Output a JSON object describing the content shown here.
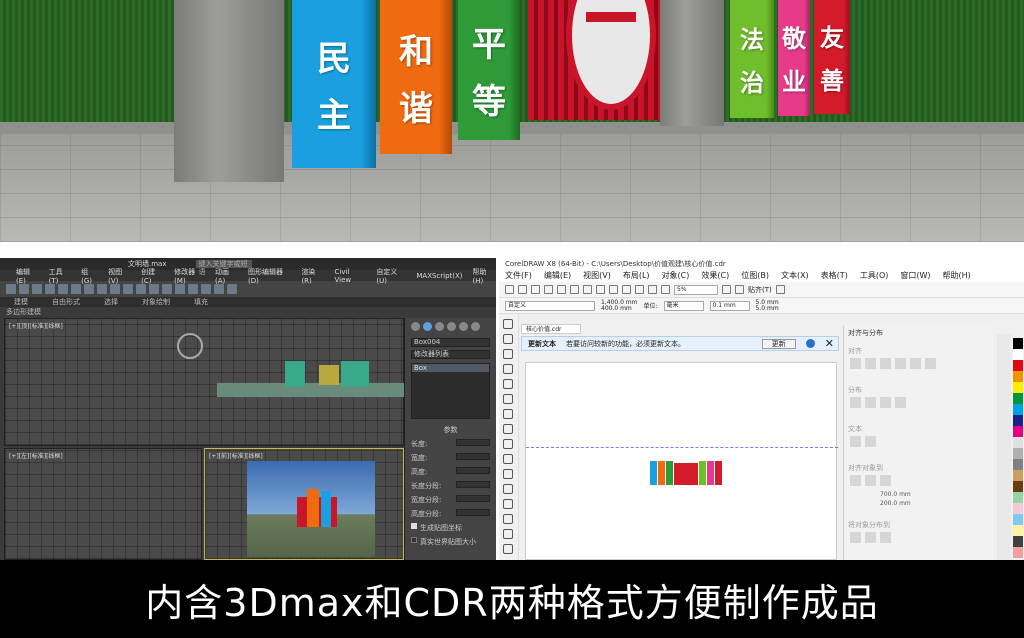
{
  "scene": {
    "boards": [
      {
        "text": [
          "民",
          "主"
        ],
        "color": "#1aa0e0",
        "side": "#0b6fa0"
      },
      {
        "text": [
          "和",
          "谐"
        ],
        "color": "#f06a10",
        "side": "#b34a05"
      },
      {
        "text": [
          "平",
          "等"
        ],
        "color": "#2e9b38",
        "side": "#1d6b24"
      },
      {
        "text": [
          "法",
          "治"
        ],
        "color": "#6fbe2c",
        "side": "#4d8a1d"
      },
      {
        "text": [
          "敬",
          "业"
        ],
        "color": "#e83a8a",
        "side": "#a82361"
      },
      {
        "text": [
          "友",
          "善"
        ],
        "color": "#d51a2a",
        "side": "#981220"
      }
    ]
  },
  "max_window": {
    "title": "文明墙.max",
    "search_placeholder": "键入关键字或短语",
    "menu": [
      "编辑(E)",
      "工具(T)",
      "组(G)",
      "视图(V)",
      "创建(C)",
      "修改器(M)",
      "动画(A)",
      "图形编辑器(D)",
      "渲染(R)",
      "Civil View",
      "自定义(U)",
      "MAXScript(X)",
      "帮助(H)"
    ],
    "ribbon_tabs": [
      "建模",
      "自由形式",
      "选择",
      "对象绘制",
      "填充"
    ],
    "subtab": "多边形建模",
    "viewport_labels": [
      "[+][顶][标准][线框]",
      "[+][左][标准][线框]",
      "[+][前][标准][线框]",
      "[+][透视][标准][默认明暗处理]"
    ],
    "object_name": "Box004",
    "modifier_list": "修改器列表",
    "modifier_item": "Box",
    "params_header": "参数",
    "params": [
      {
        "label": "长度:"
      },
      {
        "label": "宽度:"
      },
      {
        "label": "高度:"
      },
      {
        "label": "长度分段:"
      },
      {
        "label": "宽度分段:"
      },
      {
        "label": "高度分段:"
      }
    ],
    "checkboxes": [
      "生成贴图坐标",
      "真实世界贴图大小"
    ]
  },
  "cdr_window": {
    "title": "CorelDRAW X8 (64-Bit) - C:\\Users\\Desktop\\价值观建\\核心价值.cdr",
    "menu": [
      "文件(F)",
      "编辑(E)",
      "视图(V)",
      "布局(L)",
      "对象(C)",
      "效果(C)",
      "位图(B)",
      "文本(X)",
      "表格(T)",
      "工具(O)",
      "窗口(W)",
      "帮助(H)"
    ],
    "zoom": "5%",
    "snap_label": "贴齐(T)",
    "preset": "自定义",
    "width_mm": "1,400.0 mm",
    "height_mm": "400.0 mm",
    "unit_label": "单位:",
    "unit": "毫米",
    "nudge": "0.1 mm",
    "dup_x": "5.0 mm",
    "dup_y": "5.0 mm",
    "doc_tab": "核心价值.cdr",
    "notice_title": "更新文本",
    "notice_text": "若要访问较新的功能，必须更新文本。",
    "notice_button": "更新",
    "docker_title": "对齐与分布",
    "docker_sections": [
      "对齐",
      "分布",
      "文本",
      "对齐对象到",
      "将对象分布到"
    ],
    "coord_x": "700.0 mm",
    "coord_y": "200.0 mm",
    "design_colors": [
      "#1aa0e0",
      "#f06a10",
      "#2e9b38",
      "#d51a2a",
      "#6fbe2c",
      "#e83a8a",
      "#d51a2a"
    ],
    "palette": [
      "#000000",
      "#ffffff",
      "#e30613",
      "#f39200",
      "#ffed00",
      "#009640",
      "#00a0e9",
      "#1d2088",
      "#e4007f",
      "#e0e0e0",
      "#b0b0b0",
      "#808080",
      "#c8a060",
      "#6a3b10",
      "#98d4a0",
      "#f8c8d8",
      "#80c8f0",
      "#fff2a0",
      "#404040",
      "#f0a0a0"
    ]
  },
  "caption": "内含3Dmax和CDR两种格式方便制作成品"
}
